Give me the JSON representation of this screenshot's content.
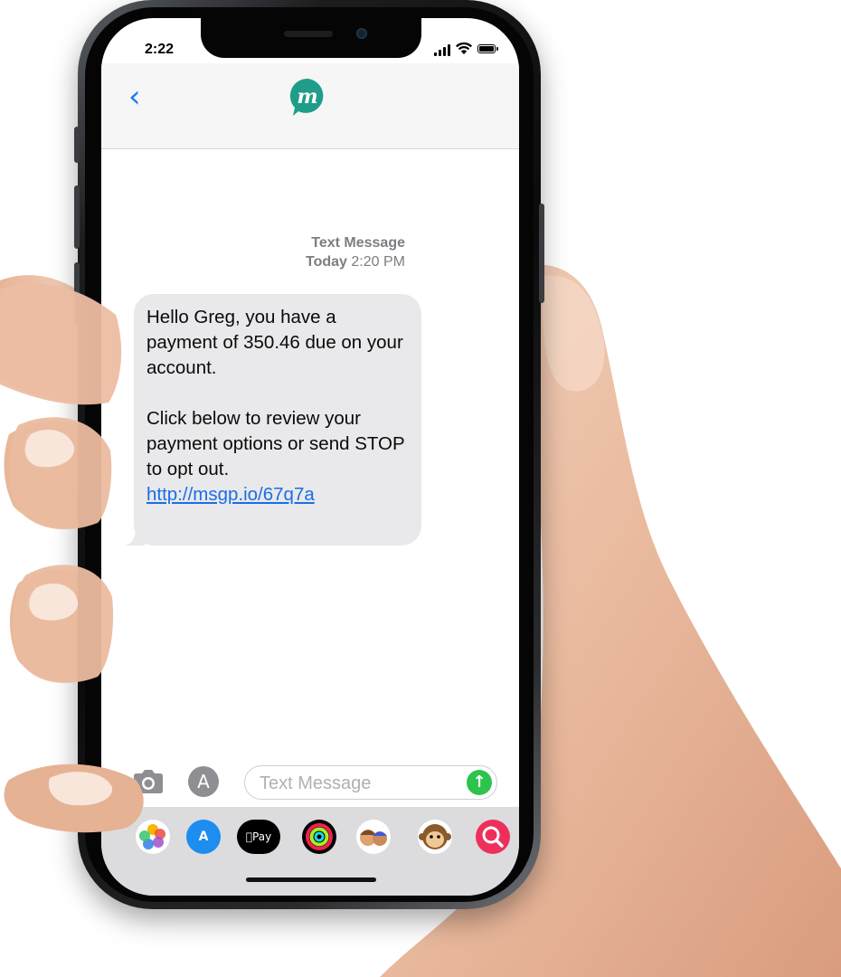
{
  "status_bar": {
    "time": "2:22"
  },
  "header": {
    "back_icon": "chevron-left-icon",
    "avatar_letter": "m",
    "avatar_color": "#1f9d8a"
  },
  "conversation": {
    "timestamp_title": "Text Message",
    "timestamp_day": "Today",
    "timestamp_time": "2:20 PM",
    "message": {
      "paragraph1": "Hello Greg, you have a payment of 350.46 due on your account.",
      "paragraph2": "Click below to review your payment options or send STOP to opt out.",
      "link": "http://msgp.io/67q7a"
    }
  },
  "input_bar": {
    "camera_icon": "camera-icon",
    "apps_icon": "app-store-icon",
    "placeholder": "Text Message",
    "send_icon": "send-arrow-icon"
  },
  "app_drawer": {
    "apps": [
      {
        "icon": "photos-icon"
      },
      {
        "icon": "app-store-icon"
      },
      {
        "icon": "apple-pay-icon",
        "label": "Pay"
      },
      {
        "icon": "activity-icon"
      },
      {
        "icon": "memoji-icon"
      },
      {
        "icon": "animoji-icon"
      },
      {
        "icon": "web-search-icon"
      }
    ]
  },
  "colors": {
    "imessage_blue": "#1a7cf5",
    "send_green": "#2cc44d",
    "bubble_gray": "#e9e9eb"
  }
}
